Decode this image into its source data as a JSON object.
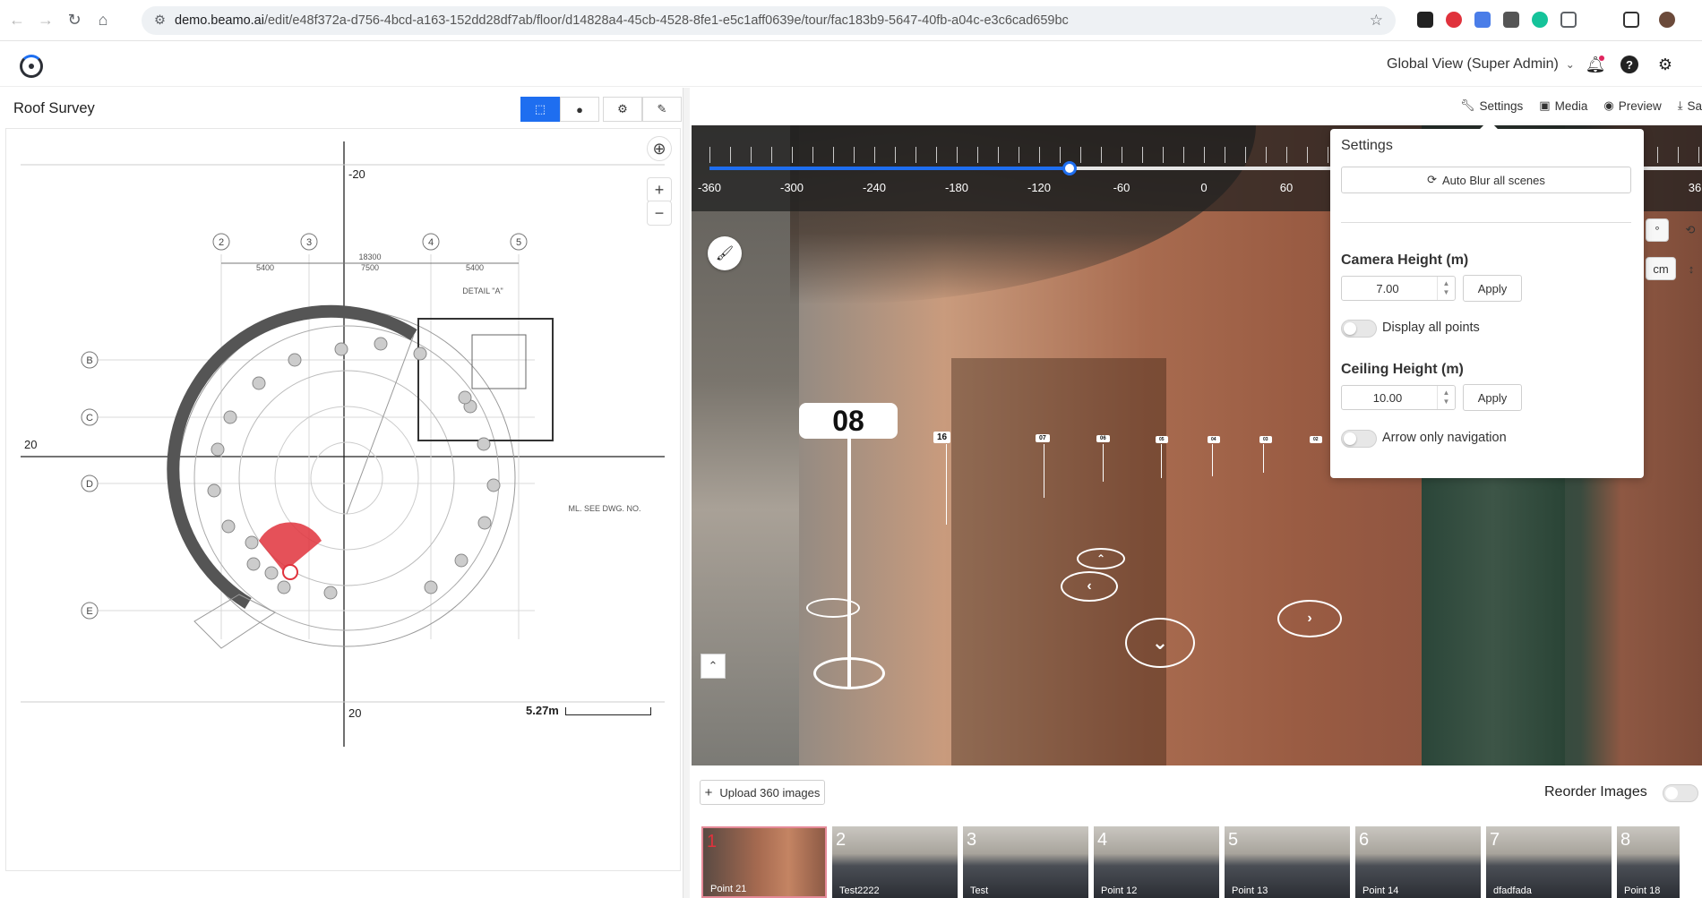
{
  "browser": {
    "url_host": "demo.beamo.ai",
    "url_path": "/edit/e48f372a-d756-4bcd-a163-152dd28df7ab/floor/d14828a4-45cb-4528-8fe1-e5c1aff0639e/tour/fac183b9-5647-40fb-a04c-e3c6cad659bc"
  },
  "header": {
    "view_label": "Global View (Super Admin)"
  },
  "left": {
    "title": "Roof Survey",
    "map_labels": {
      "top": "-20",
      "bottom": "20",
      "left": "20",
      "scale": "5.27m"
    },
    "drawing_text": {
      "dim_total": "18300",
      "dim_mid": "7500",
      "dim_left": "5400",
      "dim_right": "5400",
      "detail": "DETAIL \"A\"",
      "note": "ML. SEE DWG. NO."
    },
    "grid": [
      "2",
      "3",
      "4",
      "5"
    ],
    "rows": [
      "B",
      "C",
      "D",
      "E"
    ]
  },
  "right": {
    "actions": [
      {
        "icon": "wrench-icon",
        "label": "Settings"
      },
      {
        "icon": "media-icon",
        "label": "Media"
      },
      {
        "icon": "eye-icon",
        "label": "Preview"
      },
      {
        "icon": "download-icon",
        "label": "Sa"
      }
    ],
    "timeline": {
      "ticks": [
        "-360",
        "-300",
        "-240",
        "-180",
        "-120",
        "-60",
        "0",
        "60",
        "36"
      ],
      "value": -100
    },
    "markers": {
      "big": "08",
      "small": [
        "16",
        "07",
        "06",
        "05",
        "04",
        "03",
        "02"
      ]
    },
    "side_units": [
      "°",
      "cm"
    ],
    "upload_label": "Upload 360 images",
    "reorder_label": "Reorder Images",
    "thumbnails": [
      {
        "num": "1",
        "cap": "Point 21"
      },
      {
        "num": "2",
        "cap": "Test2222"
      },
      {
        "num": "3",
        "cap": "Test"
      },
      {
        "num": "4",
        "cap": "Point 12"
      },
      {
        "num": "5",
        "cap": "Point 13"
      },
      {
        "num": "6",
        "cap": "Point 14"
      },
      {
        "num": "7",
        "cap": "dfadfada"
      },
      {
        "num": "8",
        "cap": "Point 18"
      }
    ]
  },
  "settings": {
    "title": "Settings",
    "auto_blur": "Auto Blur all scenes",
    "camera_height_label": "Camera Height (m)",
    "camera_height_value": "7.00",
    "apply": "Apply",
    "display_all_points": "Display all points",
    "ceiling_height_label": "Ceiling Height (m)",
    "ceiling_height_value": "10.00",
    "arrow_only_nav": "Arrow only navigation"
  },
  "colors": {
    "accent": "#1e6ef0",
    "marker_red": "#e0323c"
  }
}
